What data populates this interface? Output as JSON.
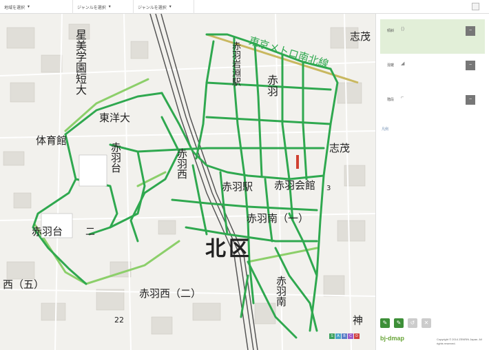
{
  "toolbar": {
    "menus": [
      {
        "label": "地域を選択"
      },
      {
        "label": "ジャンルを選択"
      },
      {
        "label": "ジャンルを選択"
      }
    ]
  },
  "map": {
    "labels": {
      "seibi": "星美学園短大",
      "toyo": "東洋大",
      "akabanedai1": "赤羽台",
      "taiikukan": "体育館",
      "akabanedai2": "赤羽台",
      "akabanenishi1": "赤羽西",
      "akabane_eki_n": "赤羽岩淵駅",
      "akabane": "赤羽",
      "akabane_eki": "赤羽駅",
      "kaikan": "赤羽会館",
      "akabaneminami": "赤羽南（一）",
      "kitaku": "北区",
      "metro": "東京メトロ南北線",
      "shimo": "志茂",
      "shimo2": "志茂",
      "nishi5": "西（五）",
      "akabanenishi2": "赤羽西（二）",
      "akabaneminami2": "赤羽南",
      "kami": "神",
      "num22": "22",
      "num3": "3",
      "ni": "二"
    },
    "route_color": "#2fa84f",
    "route_light_color": "#8ccf6a",
    "swatch_letters": [
      "S",
      "A",
      "B",
      "C",
      "D"
    ]
  },
  "panel": {
    "layers": [
      {
        "label": "傾斜",
        "active": true
      },
      {
        "label": "混雑",
        "active": false
      },
      {
        "label": "階段",
        "active": false
      }
    ],
    "legend_label": "凡例",
    "logo": "bj-dmap",
    "copyright": "Copyright © 2014 ZENRIN Japan. All rights reserved."
  }
}
